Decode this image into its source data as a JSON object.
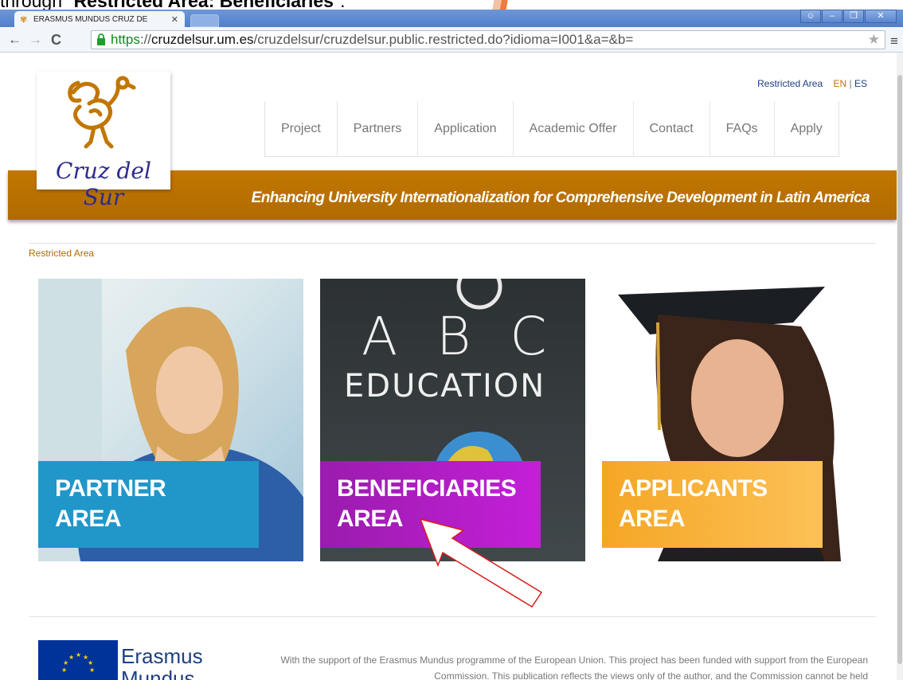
{
  "caption": {
    "prefix": "through \"",
    "bold": "Restricted Area: Beneficiaries",
    "suffix": "\"."
  },
  "browser": {
    "tab_title": "ERASMUS MUNDUS CRUZ DE",
    "url_scheme": "https",
    "url_host": "cruzdelsur.um.es",
    "url_path": "/cruzdelsur/cruzdelsur.public.restricted.do?idioma=I001&a=&b=",
    "icons": [
      "back-icon",
      "forward-icon",
      "reload-icon",
      "lock-icon",
      "star-icon",
      "menu-icon"
    ]
  },
  "site": {
    "logo_text": "Cruz del Sur",
    "tagline": "Enhancing University Internationalization for Comprehensive Development in Latin America",
    "top_links": {
      "restricted": "Restricted Area",
      "lang_en": "EN",
      "lang_sep": "|",
      "lang_es": "ES"
    },
    "nav": [
      "Project",
      "Partners",
      "Application",
      "Academic Offer",
      "Contact",
      "FAQs",
      "Apply"
    ],
    "breadcrumb": "Restricted Area",
    "brand_color": "#c27600"
  },
  "cards": [
    {
      "line1": "PARTNER",
      "line2": "AREA",
      "color": "#2196c9"
    },
    {
      "line1": "BENEFICIARIES",
      "line2": "AREA",
      "color": "#b21fc6",
      "board": {
        "row1": "A B C",
        "row2": "EDUCATION"
      }
    },
    {
      "line1": "APPLICANTS",
      "line2": "AREA",
      "color": "#f5a625"
    }
  ],
  "footer": {
    "brand_line1": "Erasmus",
    "brand_line2": "Mundus",
    "text": "With the support of the Erasmus Mundus programme of the European Union. This project has been funded with support from the European Commission. This publication reflects the views only of the author, and the Commission cannot be held"
  }
}
